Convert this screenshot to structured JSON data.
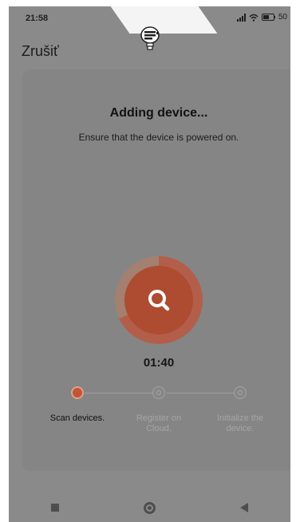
{
  "status_bar": {
    "time": "21:58",
    "battery": "50"
  },
  "header": {
    "cancel_label": "Zrušiť"
  },
  "card": {
    "title": "Adding device...",
    "subtitle": "Ensure that the device is powered on.",
    "timer": "01:40"
  },
  "steps": [
    {
      "label": "Scan devices.",
      "state": "active"
    },
    {
      "label": "Register on Cloud.",
      "state": "pending"
    },
    {
      "label": "Initialize the device.",
      "state": "pending"
    }
  ],
  "colors": {
    "accent": "#c15537",
    "overlay": "#8a8a8a"
  },
  "icons": [
    "bulb-icon",
    "search-icon",
    "signal-icon",
    "wifi-icon",
    "battery-icon"
  ]
}
